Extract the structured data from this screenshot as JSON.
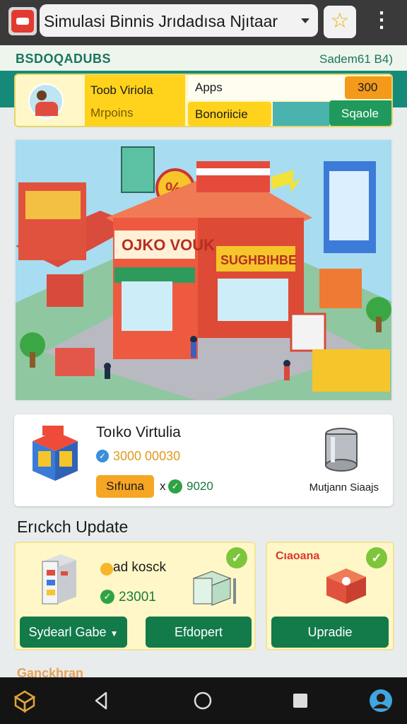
{
  "appbar": {
    "title": "Simulasi Binnis Jrıdadısa Njıtaar",
    "star_icon": "star-icon",
    "menu_icon": "more-vert-icon"
  },
  "header": {
    "brand": "BSDOQADUBS",
    "saldo": "Sadem61 B4)"
  },
  "info": {
    "cell1": "Toob Viriola",
    "cell2": "Mrpoins",
    "cell3": "Apps",
    "cell4": "300",
    "cell5": "Bonoriicie",
    "cell6": "Sqaole"
  },
  "scene": {
    "shop_sign": "OJKO VOUK",
    "side_sign": "SUGHBIHBE",
    "sale_badge": "%"
  },
  "store": {
    "title": "Toıko Virtulia",
    "money": "3000 00030",
    "status": "Sıfıuna",
    "x_mark": "x",
    "stat": "9020",
    "tank_label": "Mutjann Siaajs"
  },
  "section": {
    "title": "Erıckch Update"
  },
  "upgrades": [
    {
      "title": "ad kosck",
      "value": "23001",
      "dropdown": "Sydearl Gabe",
      "button": "Efdopert"
    },
    {
      "title": "Cıaoana",
      "button": "Upradie"
    }
  ],
  "footer": {
    "peek": "Ganckhran"
  },
  "colors": {
    "teal": "#168a78",
    "yellow": "#ffd21c",
    "green_button": "#137a4a",
    "orange": "#f39a1b"
  }
}
